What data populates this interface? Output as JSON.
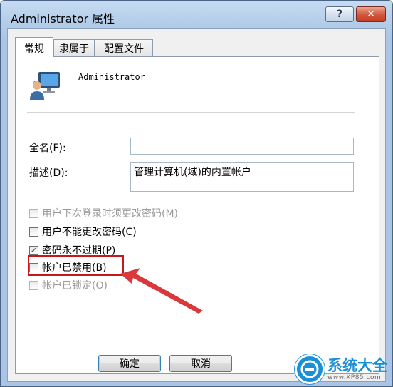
{
  "window": {
    "title": "Administrator 属性",
    "help_label": "?",
    "close_label": "✕"
  },
  "tabs": [
    {
      "label": "常规",
      "active": true
    },
    {
      "label": "隶属于",
      "active": false
    },
    {
      "label": "配置文件",
      "active": false
    }
  ],
  "user": {
    "icon": "user-monitor-icon",
    "name": "Administrator"
  },
  "fields": {
    "fullname_label": "全名(F):",
    "fullname_value": "",
    "description_label": "描述(D):",
    "description_value": "管理计算机(域)的内置帐户"
  },
  "options": [
    {
      "label": "用户下次登录时须更改密码(M)",
      "checked": false,
      "enabled": false
    },
    {
      "label": "用户不能更改密码(C)",
      "checked": false,
      "enabled": true
    },
    {
      "label": "密码永不过期(P)",
      "checked": true,
      "enabled": true
    },
    {
      "label": "帐户已禁用(B)",
      "checked": false,
      "enabled": true
    },
    {
      "label": "帐户已锁定(O)",
      "checked": false,
      "enabled": false
    }
  ],
  "annotation": {
    "highlight_color": "#c8161d",
    "arrow_color": "#d9383d"
  },
  "buttons": {
    "ok": "确定",
    "cancel": "取消"
  },
  "watermark": {
    "main": "系统大全",
    "sub": "www.XP85.com",
    "brand_color": "#1d8fd6"
  }
}
